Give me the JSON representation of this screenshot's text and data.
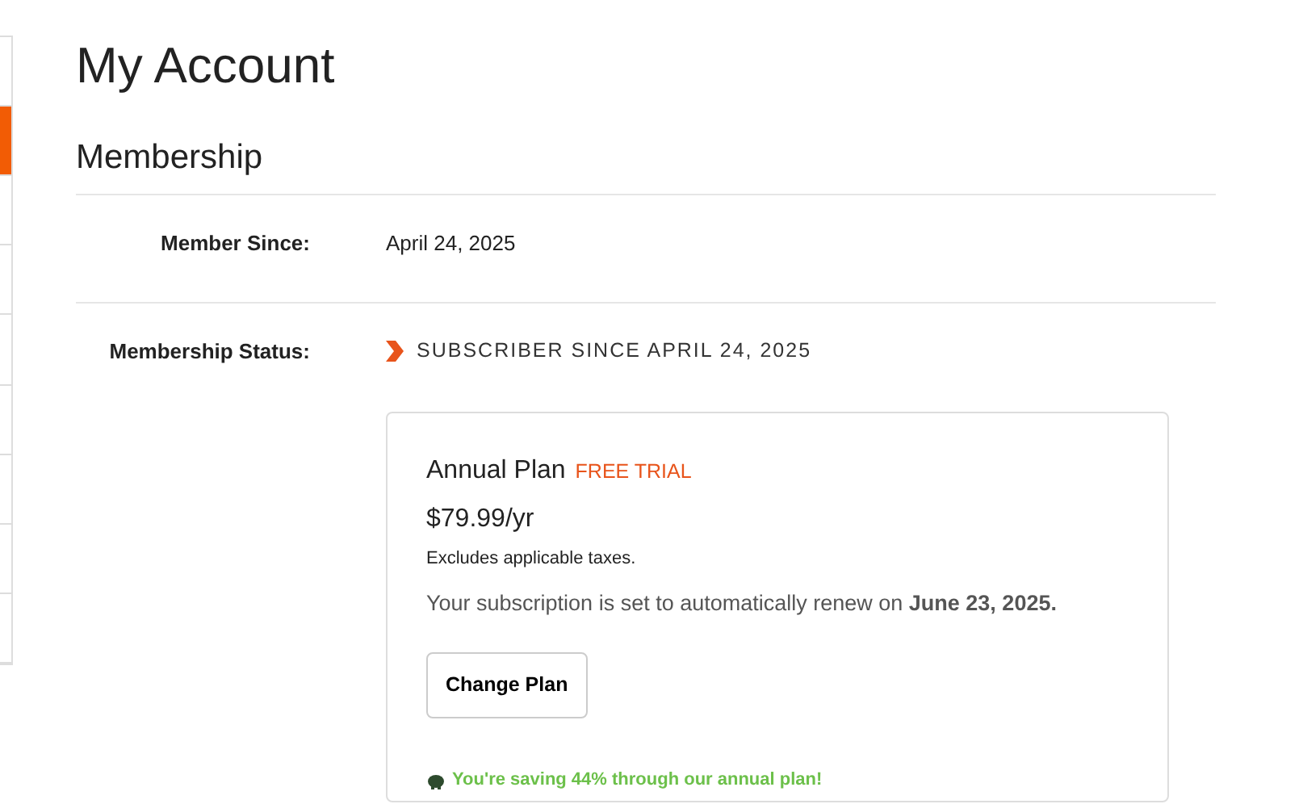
{
  "sidebar": {
    "items": [
      {
        "selected": false
      },
      {
        "selected": true
      },
      {
        "selected": false
      },
      {
        "selected": false
      },
      {
        "selected": false
      },
      {
        "selected": false
      },
      {
        "selected": false
      },
      {
        "selected": false
      },
      {
        "selected": false
      }
    ]
  },
  "title": "My Account",
  "section": "Membership",
  "rows": [
    {
      "label": "Member Since:",
      "value": "April 24, 2025"
    },
    {
      "label": "Membership Status:",
      "status": "SUBSCRIBER SINCE APRIL 24, 2025"
    }
  ],
  "plan": {
    "name": "Annual Plan",
    "badge": "FREE TRIAL",
    "price": "$79.99/yr",
    "tax_note": "Excludes applicable taxes.",
    "renewal": "Your subscription is set to automatically renew on **June 23, 2025.**",
    "button": "Change Plan",
    "savings": "You're saving 44% through our annual plan!"
  }
}
